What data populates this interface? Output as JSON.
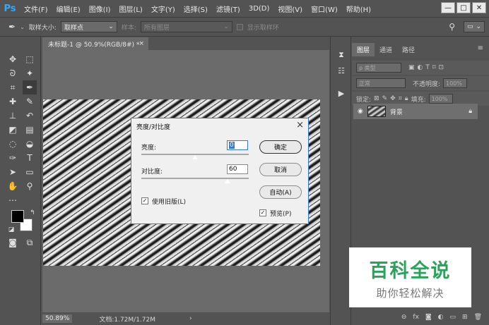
{
  "app": {
    "logo": "Ps"
  },
  "menu": [
    "文件(F)",
    "编辑(E)",
    "图像(I)",
    "图层(L)",
    "文字(Y)",
    "选择(S)",
    "滤镜(T)",
    "3D(D)",
    "视图(V)",
    "窗口(W)",
    "帮助(H)"
  ],
  "window_buttons": {
    "minimize": "—",
    "maximize": "□",
    "close": "✕"
  },
  "options": {
    "sample_size_label": "取样大小:",
    "sample_size_value": "取样点",
    "sample_label": "样本:",
    "sample_value": "所有图层",
    "show_ring_label": "显示取样环"
  },
  "document": {
    "tab_title": "未标题-1 @ 50.9%(RGB/8#) *",
    "zoom": "50.89%",
    "doc_info": "文档:1.72M/1.72M"
  },
  "dialog": {
    "title": "亮度/对比度",
    "brightness_label": "亮度:",
    "brightness_value": "0",
    "contrast_label": "对比度:",
    "contrast_value": "60",
    "brightness_position": 0.5,
    "contrast_position": 0.8,
    "use_legacy_label": "使用旧版(L)",
    "use_legacy_checked": true,
    "ok_label": "确定",
    "cancel_label": "取消",
    "auto_label": "自动(A)",
    "preview_label": "预览(P)",
    "preview_checked": true
  },
  "layers_panel": {
    "tabs": [
      "图层",
      "通道",
      "路径"
    ],
    "active_tab": "图层",
    "kind_label": "ρ 类型",
    "blend_mode": "正常",
    "opacity_label": "不透明度:",
    "opacity_value": "100%",
    "lock_label": "锁定:",
    "fill_label": "填充:",
    "fill_value": "100%",
    "layers": [
      {
        "name": "背景",
        "locked": true,
        "visible": true
      }
    ]
  },
  "watermark": {
    "title": "百科全说",
    "subtitle": "助你轻松解决"
  },
  "colors": {
    "ui_bg": "#535353",
    "dialog_bg": "#f0f0f0",
    "accent": "#31a8ff",
    "watermark_green": "#29a35a"
  }
}
